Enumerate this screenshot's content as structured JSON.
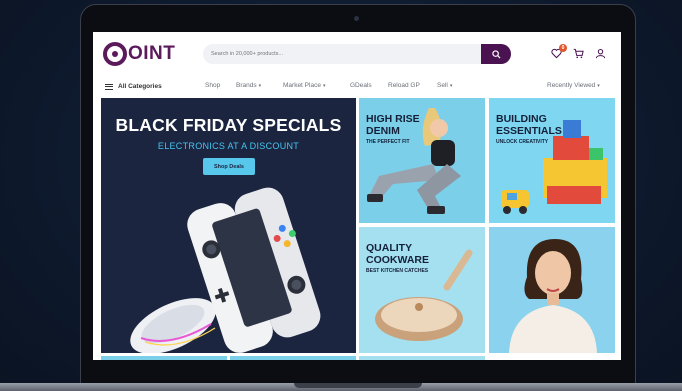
{
  "brand": {
    "logo_text": "OINT"
  },
  "header": {
    "search_placeholder": "Search in 20,000+ products...",
    "cart_count": "0",
    "icons": [
      "search-icon",
      "heart-icon",
      "cart-icon",
      "user-icon"
    ]
  },
  "nav": {
    "all_categories": "All Categories",
    "items": [
      "Shop",
      "Brands",
      "Market Place",
      "GDeals",
      "Reload GP",
      "Sell"
    ],
    "recently_viewed": "Recently Viewed"
  },
  "banners": {
    "main": {
      "title": "BLACK FRIDAY SPECIALS",
      "subtitle": "ELECTRONICS AT A DISCOUNT",
      "button": "Shop Deals"
    },
    "denim": {
      "title_line1": "HIGH RISE",
      "title_line2": "DENIM",
      "subtitle": "THE PERFECT FIT"
    },
    "build": {
      "title_line1": "BUILDING",
      "title_line2": "ESSENTIALS",
      "subtitle": "UNLOCK CREATIVITY"
    },
    "cook": {
      "title_line1": "QUALITY",
      "title_line2": "COOKWARE",
      "subtitle": "BEST KITCHEN CATCHES"
    }
  },
  "colors": {
    "brand": "#5a1a5c",
    "search_button": "#4a1250",
    "main_banner_bg": "#1c2540",
    "accent_cyan": "#45c3ee",
    "tile_blue": "#7ccfe8"
  }
}
